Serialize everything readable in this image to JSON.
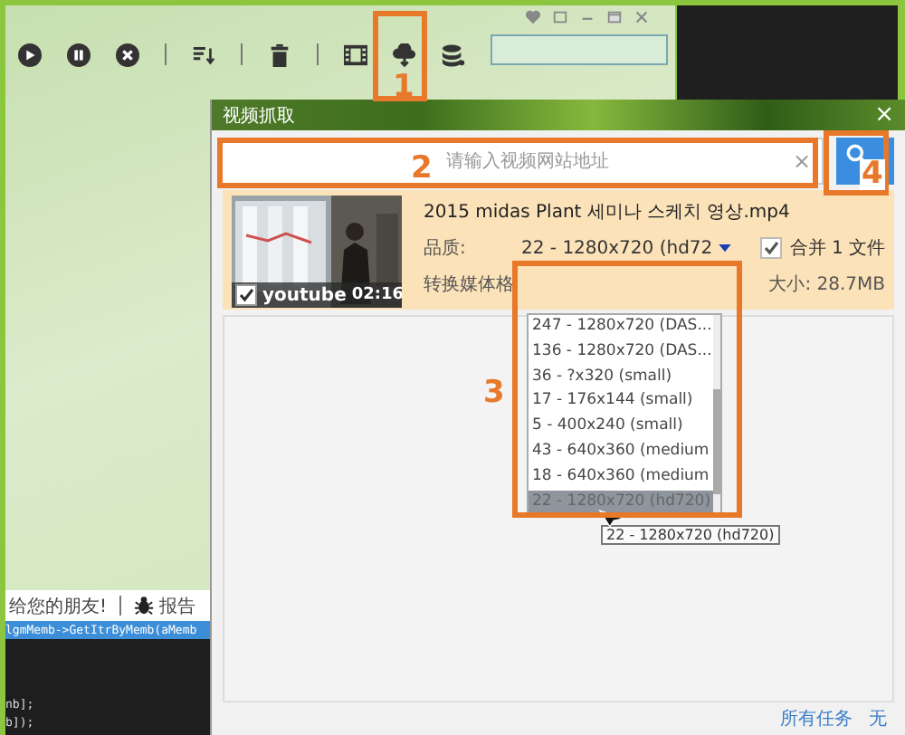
{
  "main_window": {
    "toolbar": [
      {
        "kind": "play"
      },
      {
        "kind": "pause"
      },
      {
        "kind": "cancel"
      },
      {
        "kind": "separator"
      },
      {
        "kind": "sort"
      },
      {
        "kind": "separator"
      },
      {
        "kind": "trash"
      },
      {
        "kind": "separator"
      },
      {
        "kind": "film"
      },
      {
        "kind": "cloud-download"
      },
      {
        "kind": "database"
      }
    ],
    "share_text": "给您的朋友!",
    "report_text": "报告",
    "code_lines": [
      {
        "text": "lgmMemb->GetItrByMemb(aMemb",
        "selected": true
      },
      {
        "text": "nb];",
        "selected": false
      },
      {
        "text": "b]);",
        "selected": false
      }
    ]
  },
  "dialog": {
    "title": "视频抓取",
    "close": "×",
    "search": {
      "placeholder": "请输入视频网站地址",
      "clear": "×"
    },
    "item": {
      "title": "2015 midas Plant 세미나 스케치 영상.mp4",
      "checked": true,
      "source": "youtube",
      "duration": "02:16",
      "quality_label": "品质:",
      "quality": "22 - 1280x720 (hd72",
      "merge_checked": true,
      "merge_label": "合并 1 文件",
      "convert_label": "转换媒体格",
      "size": "大小: 28.7MB"
    },
    "options": [
      {
        "label": "247 - 1280x720 (DAS...",
        "selected": false
      },
      {
        "label": "136 - 1280x720 (DAS...",
        "selected": false
      },
      {
        "label": "36 - ?x320 (small)",
        "selected": false
      },
      {
        "label": "17 - 176x144 (small)",
        "selected": false
      },
      {
        "label": "5 - 400x240 (small)",
        "selected": false
      },
      {
        "label": "43 - 640x360 (medium",
        "selected": false
      },
      {
        "label": "18 - 640x360 (medium",
        "selected": false
      },
      {
        "label": "22 - 1280x720 (hd720)",
        "selected": true
      }
    ],
    "tooltip": "22 - 1280x720 (hd720)",
    "footer": {
      "link": "所有任务",
      "value": "无"
    }
  },
  "annotations": [
    {
      "label": "1"
    },
    {
      "label": "2"
    },
    {
      "label": "3"
    },
    {
      "label": "4"
    }
  ]
}
